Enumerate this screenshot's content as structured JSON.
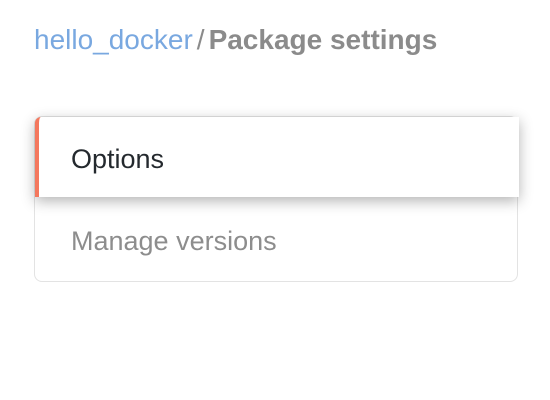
{
  "breadcrumb": {
    "repo": "hello_docker",
    "separator": "/",
    "current": "Package settings"
  },
  "menu": {
    "items": [
      {
        "label": "Options",
        "selected": true
      },
      {
        "label": "Manage versions",
        "selected": false
      }
    ],
    "accent_color": "#f4785e"
  },
  "colors": {
    "link": "#79a8e0",
    "muted_text": "#8b8b8b",
    "primary_text": "#24292e"
  }
}
